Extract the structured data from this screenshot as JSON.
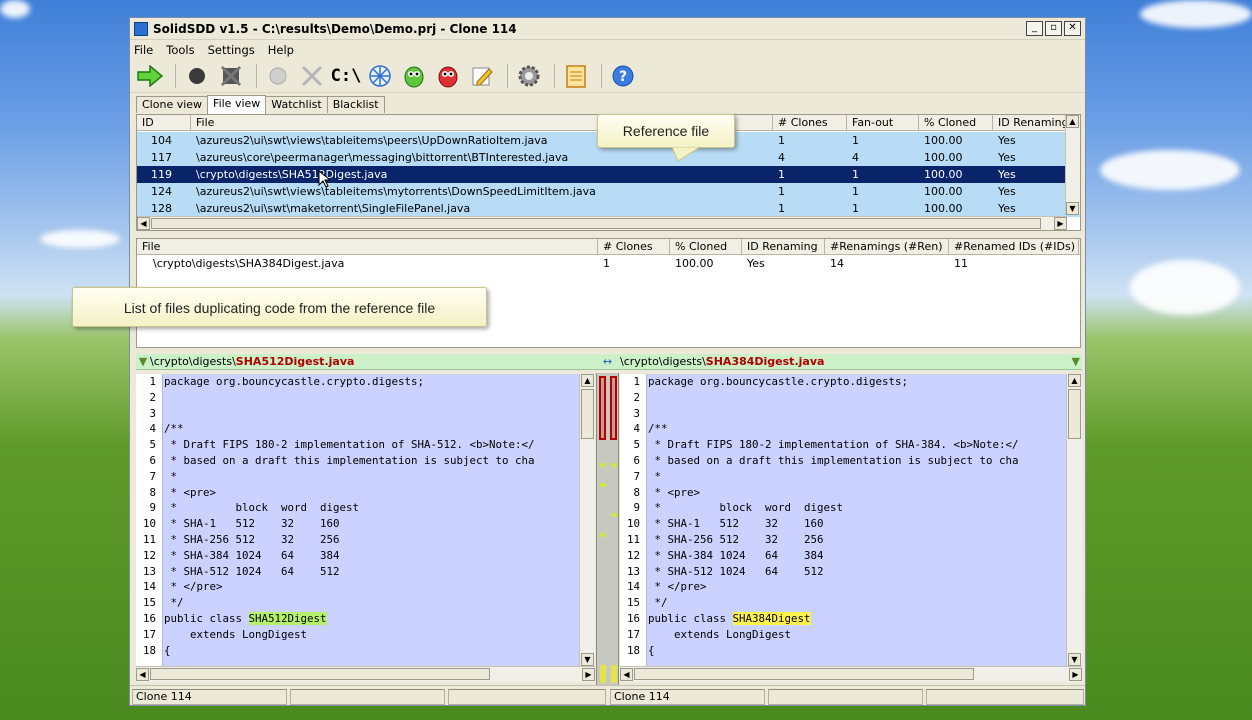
{
  "window": {
    "title": "SolidSDD v1.5 - C:\\results\\Demo\\Demo.prj - Clone 114",
    "minimize": "_",
    "maximize": "▫",
    "close": "✕"
  },
  "menu": {
    "file": "File",
    "tools": "Tools",
    "settings": "Settings",
    "help": "Help"
  },
  "toolbar": {
    "path_label": "C:\\"
  },
  "tabs": {
    "clone_view": "Clone view",
    "file_view": "File view",
    "watchlist": "Watchlist",
    "blacklist": "Blacklist"
  },
  "top_table": {
    "headers": {
      "id": "ID",
      "file": "File",
      "clones": "# Clones",
      "fanout": "Fan-out",
      "cloned": "% Cloned",
      "idren": "ID Renaming"
    },
    "rows": [
      {
        "id": "104",
        "file": "\\azureus2\\ui\\swt\\views\\tableitems\\peers\\UpDownRatioItem.java",
        "clones": "1",
        "fanout": "1",
        "cloned": "100.00",
        "idren": "Yes"
      },
      {
        "id": "117",
        "file": "\\azureus\\core\\peermanager\\messaging\\bittorrent\\BTInterested.java",
        "clones": "4",
        "fanout": "4",
        "cloned": "100.00",
        "idren": "Yes"
      },
      {
        "id": "119",
        "file": "\\crypto\\digests\\SHA512Digest.java",
        "clones": "1",
        "fanout": "1",
        "cloned": "100.00",
        "idren": "Yes"
      },
      {
        "id": "124",
        "file": "\\azureus2\\ui\\swt\\views\\tableitems\\mytorrents\\DownSpeedLimitItem.java",
        "clones": "1",
        "fanout": "1",
        "cloned": "100.00",
        "idren": "Yes"
      },
      {
        "id": "128",
        "file": "\\azureus2\\ui\\swt\\maketorrent\\SingleFilePanel.java",
        "clones": "1",
        "fanout": "1",
        "cloned": "100.00",
        "idren": "Yes"
      }
    ]
  },
  "bottom_table": {
    "headers": {
      "file": "File",
      "clones": "# Clones",
      "cloned": "% Cloned",
      "idren": "ID Renaming",
      "renamings": "#Renamings (#Ren)",
      "renamed": "#Renamed IDs (#IDs)"
    },
    "rows": [
      {
        "file": "\\crypto\\digests\\SHA384Digest.java",
        "clones": "1",
        "cloned": "100.00",
        "idren": "Yes",
        "renamings": "14",
        "renamed": "11"
      }
    ]
  },
  "callouts": {
    "reference": "Reference file",
    "list": "List of files duplicating code from the reference file"
  },
  "left_pane": {
    "path_prefix": "\\crypto\\digests\\",
    "file_name": "SHA512Digest.java",
    "lines": [
      {
        "n": "1",
        "t": "package org.bouncycastle.crypto.digests;"
      },
      {
        "n": "2",
        "t": ""
      },
      {
        "n": "3",
        "t": ""
      },
      {
        "n": "4",
        "t": "/**"
      },
      {
        "n": "5",
        "t": " * Draft FIPS 180-2 implementation of SHA-512. <b>Note:</"
      },
      {
        "n": "6",
        "t": " * based on a draft this implementation is subject to cha"
      },
      {
        "n": "7",
        "t": " *"
      },
      {
        "n": "8",
        "t": " * <pre>"
      },
      {
        "n": "9",
        "t": " *         block  word  digest"
      },
      {
        "n": "10",
        "t": " * SHA-1   512    32    160"
      },
      {
        "n": "11",
        "t": " * SHA-256 512    32    256"
      },
      {
        "n": "12",
        "t": " * SHA-384 1024   64    384"
      },
      {
        "n": "13",
        "t": " * SHA-512 1024   64    512"
      },
      {
        "n": "14",
        "t": " * </pre>"
      },
      {
        "n": "15",
        "t": " */"
      },
      {
        "n": "16",
        "t": "public class "
      },
      {
        "n": "17",
        "t": "    extends LongDigest"
      },
      {
        "n": "18",
        "t": "{"
      }
    ],
    "class_name": "SHA512Digest"
  },
  "right_pane": {
    "path_prefix": "\\crypto\\digests\\",
    "file_name": "SHA384Digest.java",
    "lines": [
      {
        "n": "1",
        "t": "package org.bouncycastle.crypto.digests;"
      },
      {
        "n": "2",
        "t": ""
      },
      {
        "n": "3",
        "t": ""
      },
      {
        "n": "4",
        "t": "/**"
      },
      {
        "n": "5",
        "t": " * Draft FIPS 180-2 implementation of SHA-384. <b>Note:</"
      },
      {
        "n": "6",
        "t": " * based on a draft this implementation is subject to cha"
      },
      {
        "n": "7",
        "t": " *"
      },
      {
        "n": "8",
        "t": " * <pre>"
      },
      {
        "n": "9",
        "t": " *         block  word  digest"
      },
      {
        "n": "10",
        "t": " * SHA-1   512    32    160"
      },
      {
        "n": "11",
        "t": " * SHA-256 512    32    256"
      },
      {
        "n": "12",
        "t": " * SHA-384 1024   64    384"
      },
      {
        "n": "13",
        "t": " * SHA-512 1024   64    512"
      },
      {
        "n": "14",
        "t": " * </pre>"
      },
      {
        "n": "15",
        "t": " */"
      },
      {
        "n": "16",
        "t": "public class "
      },
      {
        "n": "17",
        "t": "    extends LongDigest"
      },
      {
        "n": "18",
        "t": "{"
      }
    ],
    "class_name": "SHA384Digest"
  },
  "status": {
    "left": "Clone 114",
    "right": "Clone 114"
  },
  "colors": {
    "selection": "#0a246a",
    "row_highlight": "#b9dcf6",
    "code_bg": "#ccd2ff",
    "path_bar": "#ccf0c8",
    "left_mark": "#b5f06a",
    "right_mark": "#fff34a"
  },
  "icons": [
    "run-arrow-icon",
    "stop-icon",
    "cancel-icon",
    "record-icon",
    "clear-icon",
    "path-icon",
    "snowflake-icon",
    "eye-green-icon",
    "eye-red-icon",
    "edit-icon",
    "gear-icon",
    "notes-icon",
    "help-icon"
  ]
}
